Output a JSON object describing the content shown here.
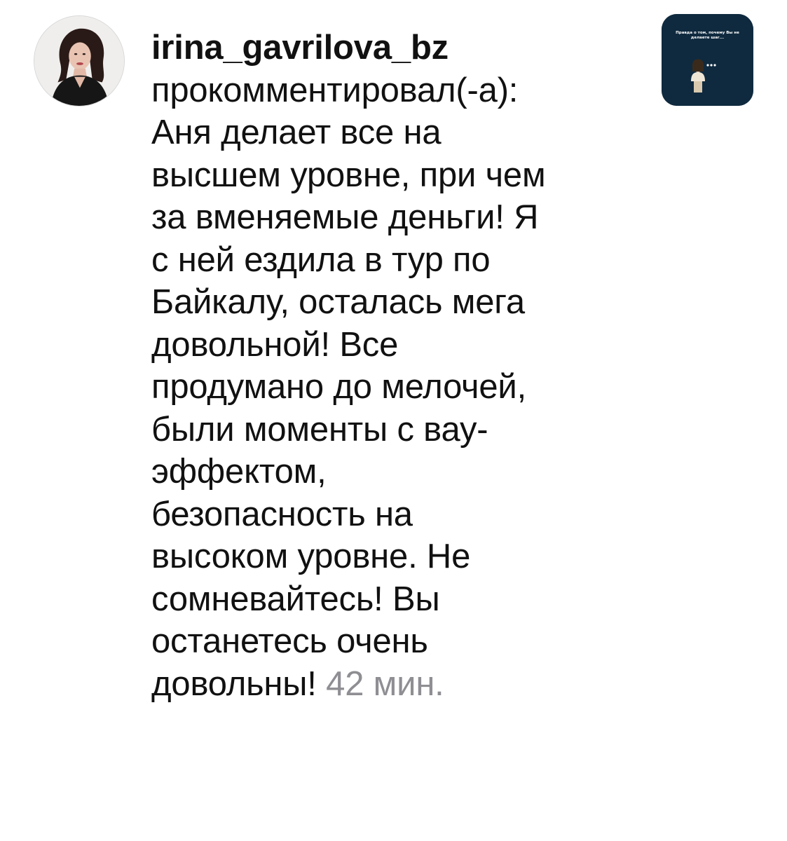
{
  "notification": {
    "username": "irina_gavrilova_bz",
    "action": "прокомментировал(-а):",
    "comment_lines": [
      "Аня делает все на",
      "высшем уровне, при чем",
      "за вменяемые деньги! Я",
      "с ней ездила в тур по",
      "Байкалу, осталась мега",
      "довольной! Все",
      "продумано до мелочей,",
      "были моменты с вау-",
      "эффектом,",
      "безопасность на",
      "высоком уровне. Не",
      "сомневайтесь! Вы",
      "останетесь очень"
    ],
    "last_line": "довольны!",
    "timestamp": "42 мин.",
    "avatar_icon": "profile-photo-avatar",
    "story_thumbnail": {
      "caption": "Правда о том, почему Вы не делаете шаг...",
      "background_color": "#0f2a3f"
    }
  }
}
